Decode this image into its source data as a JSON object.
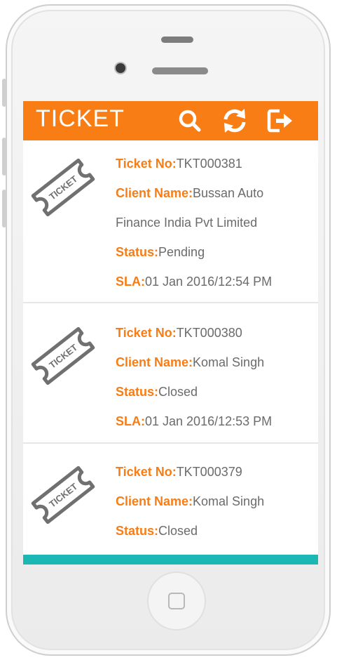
{
  "app": {
    "title": "TICKET",
    "accent_color": "#f77d14",
    "bottom_bar_color": "#1ab7b5",
    "actions": [
      {
        "icon": "search-icon"
      },
      {
        "icon": "refresh-icon"
      },
      {
        "icon": "logout-icon"
      }
    ]
  },
  "tickets": [
    {
      "icon": "ticket-icon",
      "icon_text": "TICKET",
      "ticket_no_label": "Ticket No:",
      "ticket_no": "TKT000381",
      "client_label": "Client Name:",
      "client_name_line1": "Bussan Auto",
      "client_name_line2": "Finance India Pvt Limited",
      "status_label": "Status:",
      "status": "Pending",
      "sla_label": "SLA:",
      "sla": "01 Jan 2016/12:54 PM"
    },
    {
      "icon": "ticket-icon",
      "icon_text": "TICKET",
      "ticket_no_label": "Ticket No:",
      "ticket_no": "TKT000380",
      "client_label": "Client Name:",
      "client_name_line1": "Komal Singh",
      "status_label": "Status:",
      "status": "Closed",
      "sla_label": "SLA:",
      "sla": "01 Jan 2016/12:53 PM"
    },
    {
      "icon": "ticket-icon",
      "icon_text": "TICKET",
      "ticket_no_label": "Ticket No:",
      "ticket_no": "TKT000379",
      "client_label": "Client Name:",
      "client_name_line1": "Komal Singh",
      "status_label": "Status:",
      "status": "Closed"
    }
  ]
}
